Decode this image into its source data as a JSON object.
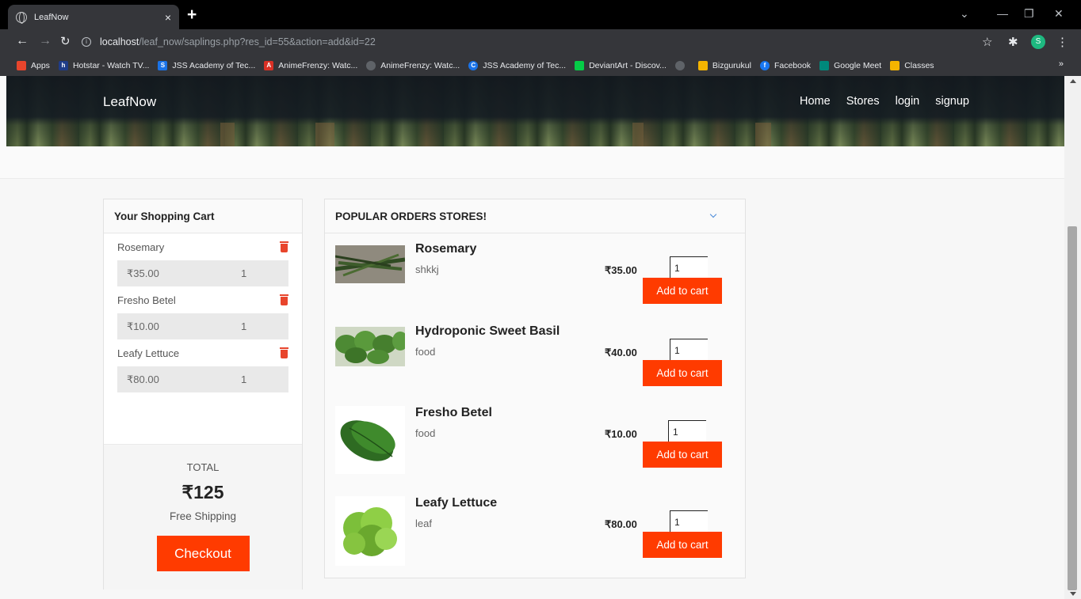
{
  "browser": {
    "tab_title": "LeafNow",
    "tab_close": "×",
    "new_tab": "+",
    "url_host": "localhost",
    "url_path": "/leaf_now/saplings.php?res_id=55&action=add&id=22",
    "profile_initial": "S",
    "bookmarks": [
      {
        "label": "Apps",
        "icon": "apps-grid-icon",
        "color": "#e8452c"
      },
      {
        "label": "Hotstar - Watch TV...",
        "icon": "hotstar-icon",
        "color": "#1f3c88"
      },
      {
        "label": "JSS Academy of Tec...",
        "icon": "jss-icon",
        "color": "#1a73e8"
      },
      {
        "label": "AnimeFrenzy: Watc...",
        "icon": "animefrenzy-icon",
        "color": "#d93025"
      },
      {
        "label": "AnimeFrenzy: Watc...",
        "icon": "globe-icon",
        "color": "#5f6368"
      },
      {
        "label": "JSS Academy of Tec...",
        "icon": "jss-c-icon",
        "color": "#1a73e8"
      },
      {
        "label": "DeviantArt - Discov...",
        "icon": "deviantart-icon",
        "color": "#05cc47"
      },
      {
        "label": "",
        "icon": "globe-icon",
        "color": "#5f6368"
      },
      {
        "label": "Bizgurukul",
        "icon": "bizgurukul-icon",
        "color": "#f4b400"
      },
      {
        "label": "Facebook",
        "icon": "facebook-icon",
        "color": "#1877f2"
      },
      {
        "label": "Google Meet",
        "icon": "google-meet-icon",
        "color": "#00897b"
      },
      {
        "label": "Classes",
        "icon": "classroom-icon",
        "color": "#f4b400"
      }
    ],
    "bookmarks_more": "»"
  },
  "site": {
    "brand": "LeafNow",
    "nav": [
      "Home",
      "Stores",
      "login",
      "signup"
    ]
  },
  "cart": {
    "title": "Your Shopping Cart",
    "items": [
      {
        "name": "Rosemary",
        "price": "₹35.00",
        "qty": "1"
      },
      {
        "name": "Fresho Betel",
        "price": "₹10.00",
        "qty": "1"
      },
      {
        "name": "Leafy Lettuce",
        "price": "₹80.00",
        "qty": "1"
      }
    ],
    "total_label": "TOTAL",
    "total_value": "₹125",
    "shipping": "Free Shipping",
    "checkout_label": "Checkout"
  },
  "popular": {
    "title": "POPULAR ORDERS STORES!",
    "add_label": "Add to cart",
    "products": [
      {
        "name": "Rosemary",
        "desc": "shkkj",
        "price": "₹35.00",
        "qty": "1",
        "image": "rosemary-image"
      },
      {
        "name": "Hydroponic Sweet Basil",
        "desc": "food",
        "price": "₹40.00",
        "qty": "1",
        "image": "basil-image"
      },
      {
        "name": "Fresho Betel",
        "desc": "food",
        "price": "₹10.00",
        "qty": "1",
        "image": "betel-leaf-image"
      },
      {
        "name": "Leafy Lettuce",
        "desc": "leaf",
        "price": "₹80.00",
        "qty": "1",
        "image": "lettuce-image"
      }
    ]
  },
  "colors": {
    "accent": "#ff3b00",
    "trash": "#e8452c"
  }
}
